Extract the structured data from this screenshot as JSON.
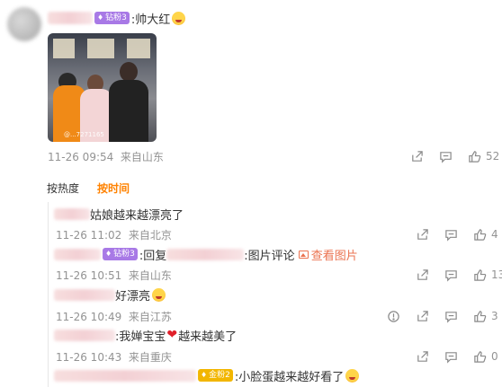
{
  "main_comment": {
    "badge": "钻粉3",
    "text": ":帅大红",
    "time": "11-26 09:54",
    "location": "来自山东",
    "likes": "52",
    "photo_watermark": "@...7271165"
  },
  "sort_tabs": {
    "hot": "按热度",
    "time": "按时间"
  },
  "replies": [
    {
      "text": "姑娘越来越漂亮了",
      "time": "11-26 11:02",
      "location": "来自北京",
      "likes": "4"
    },
    {
      "badge": "钻粉3",
      "prefix": ":回复",
      "suffix": ":图片评论",
      "link": "查看图片",
      "time": "11-26 10:51",
      "location": "来自山东",
      "likes": "13"
    },
    {
      "text": "好漂亮",
      "time": "11-26 10:49",
      "location": "来自江苏",
      "likes": "3"
    },
    {
      "text_a": ":我婵宝宝",
      "text_b": "越来越美了",
      "time": "11-26 10:43",
      "location": "来自重庆",
      "likes": "0"
    },
    {
      "badge": "金粉2",
      "text": ":小脸蛋越来越好看了"
    }
  ],
  "icons": [
    "share-icon",
    "comment-icon",
    "like-icon",
    "report-icon",
    "image-icon",
    "heart-emoji",
    "smile-emoji"
  ],
  "colors": {
    "accent": "#ff8200",
    "link": "#eb7350",
    "meta": "#939393",
    "badge_purple": "#a879e6",
    "badge_gold": "#f2b600"
  }
}
